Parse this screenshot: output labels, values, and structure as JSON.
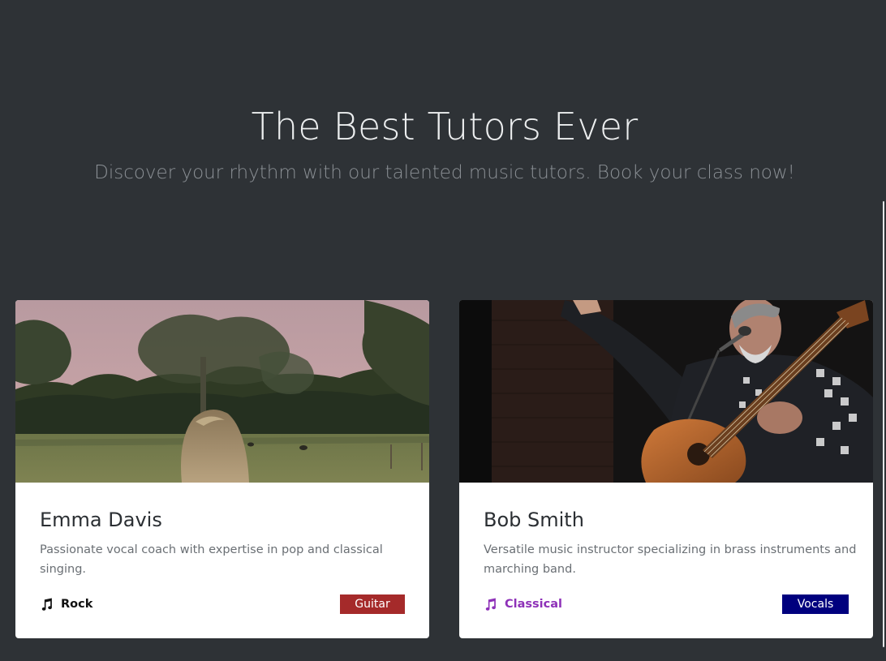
{
  "hero": {
    "title": "The Best Tutors Ever",
    "subtitle": "Discover your rhythm with our talented music tutors. Book your class now!"
  },
  "tutors": [
    {
      "image_icon": "photo-woman-in-field",
      "name": "Emma Davis",
      "description": "Passionate vocal coach with expertise in pop and classical singing.",
      "genre_icon": "music-note-icon",
      "genre": "Rock",
      "genre_color": "#111111",
      "instrument": "Guitar",
      "instrument_color": "#a52a2a"
    },
    {
      "image_icon": "photo-man-playing-guitar",
      "name": "Bob Smith",
      "description": "Versatile music instructor specializing in brass instruments and marching band.",
      "genre_icon": "music-note-icon",
      "genre": "Classical",
      "genre_color": "#8e31b8",
      "instrument": "Vocals",
      "instrument_color": "#00007e"
    }
  ],
  "colors": {
    "page_background": "#2e3236",
    "card_background": "#ffffff"
  }
}
